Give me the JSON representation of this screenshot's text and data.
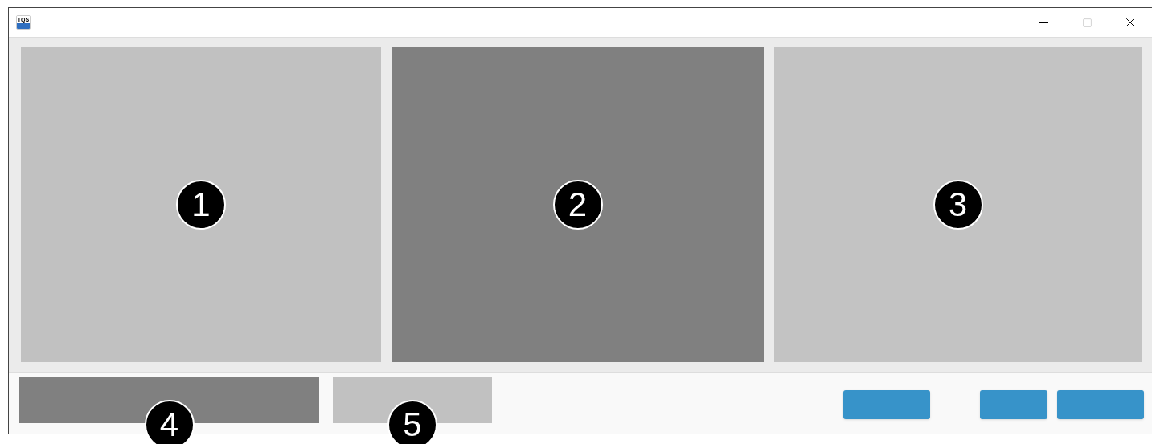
{
  "window": {
    "logo": "TQS"
  },
  "panels": [
    {
      "color": "#c1c1c1",
      "callout": "1"
    },
    {
      "color": "#808080",
      "callout": "2"
    },
    {
      "color": "#c3c3c3",
      "callout": "3"
    }
  ],
  "footer_blocks": [
    {
      "color": "#808080",
      "callout": "4"
    },
    {
      "color": "#c1c1c1",
      "callout": "5"
    }
  ],
  "buttons": [
    {
      "kind": "blank"
    },
    {
      "kind": "spacer"
    },
    {
      "kind": "blank"
    },
    {
      "kind": "blank"
    }
  ]
}
